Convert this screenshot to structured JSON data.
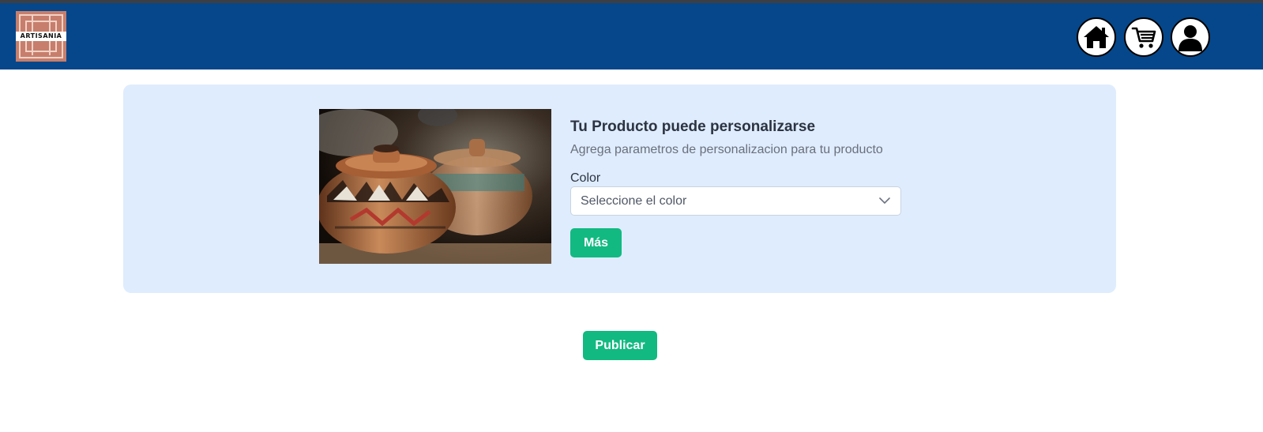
{
  "header": {
    "logo_text": "ARTISANIA",
    "colors": {
      "background": "#05478a",
      "top_strip": "#3b3f45"
    },
    "icons": [
      "home-icon",
      "cart-icon",
      "user-icon"
    ]
  },
  "customization": {
    "title": "Tu Producto puede personalizarse",
    "subtitle": "Agrega parametros de personalizacion para tu producto",
    "field_label": "Color",
    "select_placeholder": "Seleccione el color",
    "more_button": "Más",
    "card_color": "#dfecfd"
  },
  "actions": {
    "publish_button": "Publicar",
    "accent_color": "#12b981"
  }
}
